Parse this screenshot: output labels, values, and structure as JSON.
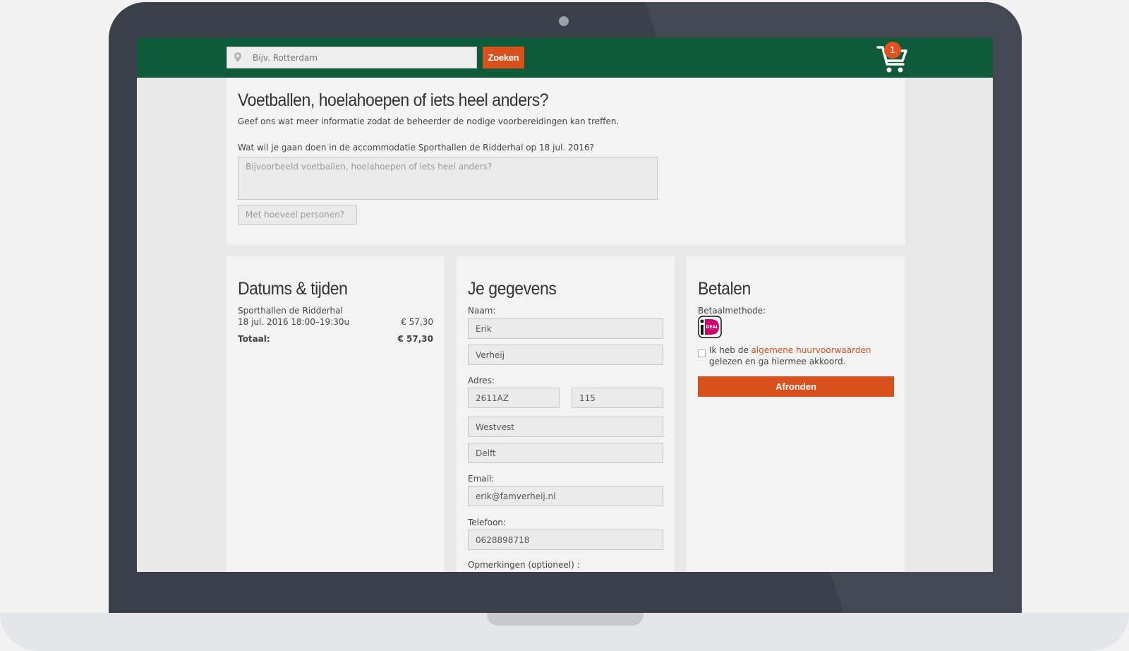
{
  "topbar": {
    "search_placeholder": "Bijv. Rotterdam",
    "search_button": "Zoeken",
    "cart_count": "1",
    "colors": {
      "bar": "#0f5a38",
      "accent": "#d9501f"
    }
  },
  "intro": {
    "title": "Voetballen, hoelahoepen of iets heel anders?",
    "subtitle": "Geef ons wat meer informatie zodat de beheerder de nodige voorbereidingen kan treffen.",
    "question": "Wat wil je gaan doen in de accommodatie Sporthallen de Ridderhal op 18 jul. 2016?",
    "activity_placeholder": "Bijvoorbeeld voetballen, hoelahoepen of iets heel anders?",
    "persons_placeholder": "Met hoeveel personen?"
  },
  "dates": {
    "title": "Datums & tijden",
    "venue": "Sporthallen de Ridderhal",
    "slot": "18 jul. 2016 18:00–19:30u",
    "slot_price": "€ 57,30",
    "total_label": "Totaal:",
    "total_price": "€ 57,30"
  },
  "details": {
    "title": "Je gegevens",
    "name_label": "Naam:",
    "first_name": "Erik",
    "last_name": "Verheij",
    "address_label": "Adres:",
    "postcode": "2611AZ",
    "house_number": "115",
    "street": "Westvest",
    "city": "Delft",
    "email_label": "Email:",
    "email": "erik@famverheij.nl",
    "phone_label": "Telefoon:",
    "phone": "0628898718",
    "remarks_label": "Opmerkingen (optioneel) :"
  },
  "payment": {
    "title": "Betalen",
    "method_label": "Betaalmethode:",
    "method_icon": "ideal-icon",
    "accept_pre": "Ik heb de ",
    "accept_link": "algemene huurvoorwaarden",
    "accept_post": " gelezen en ga hiermee akkoord.",
    "finish_button": "Afronden"
  }
}
